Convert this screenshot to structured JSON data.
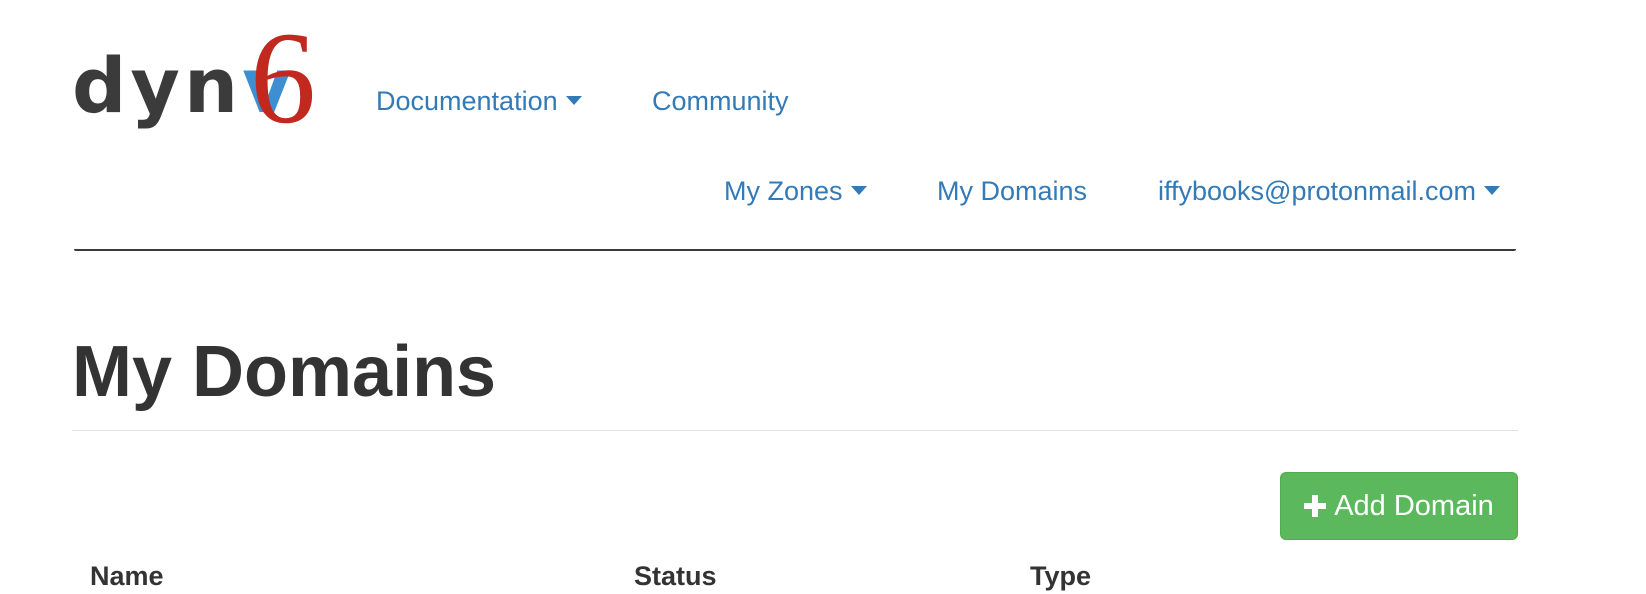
{
  "brand": {
    "logo_text": "dynv6"
  },
  "nav": {
    "documentation": "Documentation",
    "community": "Community",
    "my_zones": "My Zones",
    "my_domains": "My Domains",
    "user_email": "iffybooks@protonmail.com"
  },
  "page": {
    "title": "My Domains",
    "add_button_label": "Add Domain"
  },
  "table": {
    "columns": [
      "Name",
      "Status",
      "Type"
    ]
  },
  "colors": {
    "link": "#337ab7",
    "logo_dark": "#3b3b3b",
    "logo_blue": "#3d8fd1",
    "logo_red": "#c1281e",
    "success_button": "#5cb85c"
  },
  "icons": {
    "dropdown": "caret-down-icon",
    "add": "plus-icon"
  }
}
